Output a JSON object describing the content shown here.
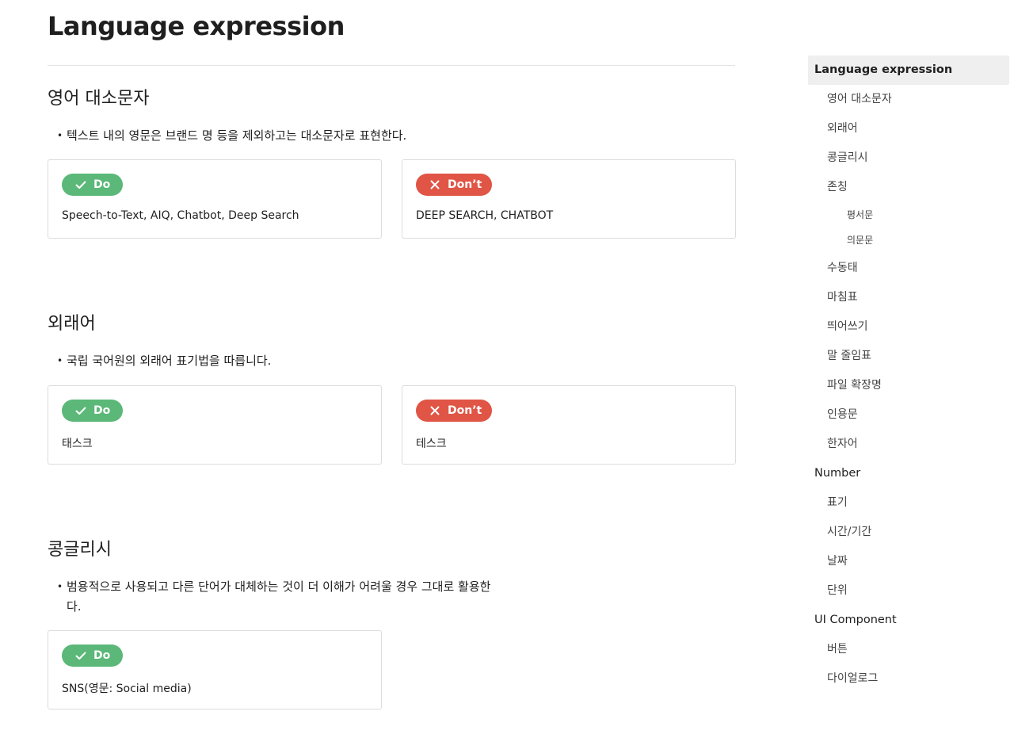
{
  "page": {
    "title": "Language expression"
  },
  "sections": [
    {
      "heading": "영어 대소문자",
      "bullet": "텍스트 내의 영문은 브랜드 명 등을 제외하고는 대소문자로 표현한다.",
      "do": {
        "label": "Do",
        "example": "Speech-to-Text, AIQ, Chatbot, Deep Search"
      },
      "dont": {
        "label": "Don’t",
        "example": "DEEP SEARCH, CHATBOT"
      }
    },
    {
      "heading": "외래어",
      "bullet": "국립 국어원의 외래어 표기법을 따릅니다.",
      "do": {
        "label": "Do",
        "example": "태스크"
      },
      "dont": {
        "label": "Don’t",
        "example": "테스크"
      }
    },
    {
      "heading": "콩글리시",
      "bullet_line1": "범용적으로 사용되고 다른 단어가 대체하는 것이 더 이해가 어려울 경우 그대로 활용한",
      "bullet_line2": "다.",
      "do": {
        "label": "Do",
        "example": "SNS(영문: Social media)"
      }
    }
  ],
  "icons": {
    "do": "check-icon",
    "dont": "close-icon"
  },
  "colors": {
    "do": "#5bb878",
    "dont": "#e05545",
    "toc_active_bg": "#efefef"
  },
  "toc": [
    {
      "label": "Language expression",
      "level": 1,
      "active": true
    },
    {
      "label": "영어 대소문자",
      "level": 2
    },
    {
      "label": "외래어",
      "level": 2
    },
    {
      "label": "콩글리시",
      "level": 2
    },
    {
      "label": "존칭",
      "level": 2
    },
    {
      "label": "평서문",
      "level": 3
    },
    {
      "label": "의문문",
      "level": 3
    },
    {
      "label": "수동태",
      "level": 2
    },
    {
      "label": "마침표",
      "level": 2
    },
    {
      "label": "띄어쓰기",
      "level": 2
    },
    {
      "label": "말 줄임표",
      "level": 2
    },
    {
      "label": "파일 확장명",
      "level": 2
    },
    {
      "label": "인용문",
      "level": 2
    },
    {
      "label": "한자어",
      "level": 2
    },
    {
      "label": "Number",
      "level": 1
    },
    {
      "label": "표기",
      "level": 2
    },
    {
      "label": "시간/기간",
      "level": 2
    },
    {
      "label": "날짜",
      "level": 2
    },
    {
      "label": "단위",
      "level": 2
    },
    {
      "label": "UI Component",
      "level": 1
    },
    {
      "label": "버튼",
      "level": 2
    },
    {
      "label": "다이얼로그",
      "level": 2
    }
  ]
}
